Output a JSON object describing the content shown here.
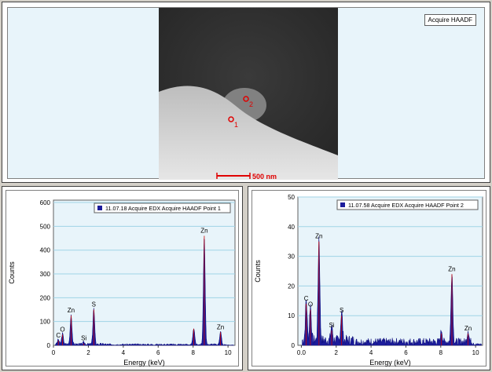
{
  "image_panel": {
    "label": "Acquire HAADF",
    "scalebar_text": "500 nm",
    "points": [
      {
        "label": "1"
      },
      {
        "label": "2"
      }
    ]
  },
  "charts": {
    "x_axis_label": "Energy (keV)",
    "y_axis_label": "Counts"
  },
  "chart_data": [
    {
      "type": "line",
      "legend": "11.07.18 Acquire EDX Acquire HAADF Point 1",
      "xlabel": "Energy (keV)",
      "ylabel": "Counts",
      "xlim": [
        0,
        10.4
      ],
      "ylim": [
        0,
        610
      ],
      "xticks": [
        0,
        2,
        4,
        6,
        8,
        10
      ],
      "yticks": [
        0,
        100,
        200,
        300,
        400,
        500,
        600
      ],
      "peaks": [
        {
          "x": 0.28,
          "y": 20,
          "label": "C"
        },
        {
          "x": 0.52,
          "y": 45,
          "label": "O"
        },
        {
          "x": 1.01,
          "y": 125,
          "label": "Zn"
        },
        {
          "x": 1.74,
          "y": 8,
          "label": "Si"
        },
        {
          "x": 2.31,
          "y": 150,
          "label": "S"
        },
        {
          "x": 8.04,
          "y": 70,
          "label": ""
        },
        {
          "x": 8.64,
          "y": 460,
          "label": "Zn"
        },
        {
          "x": 9.57,
          "y": 55,
          "label": "Zn"
        }
      ]
    },
    {
      "type": "line",
      "legend": "11.07.58 Acquire EDX Acquire HAADF Point 2",
      "xlabel": "Energy (keV)",
      "ylabel": "Counts",
      "xlim": [
        -0.2,
        10.4
      ],
      "ylim": [
        0,
        50
      ],
      "xticks": [
        0.0,
        2,
        4,
        6,
        8,
        10
      ],
      "yticks": [
        0,
        10,
        20,
        30,
        40,
        50
      ],
      "peaks": [
        {
          "x": 0.28,
          "y": 14,
          "label": "C"
        },
        {
          "x": 0.52,
          "y": 12,
          "label": "O"
        },
        {
          "x": 1.01,
          "y": 35,
          "label": "Zn"
        },
        {
          "x": 1.74,
          "y": 5,
          "label": "Si"
        },
        {
          "x": 2.31,
          "y": 10,
          "label": "S"
        },
        {
          "x": 8.04,
          "y": 4,
          "label": ""
        },
        {
          "x": 8.64,
          "y": 24,
          "label": "Zn"
        },
        {
          "x": 9.57,
          "y": 4,
          "label": "Zn"
        }
      ]
    }
  ]
}
